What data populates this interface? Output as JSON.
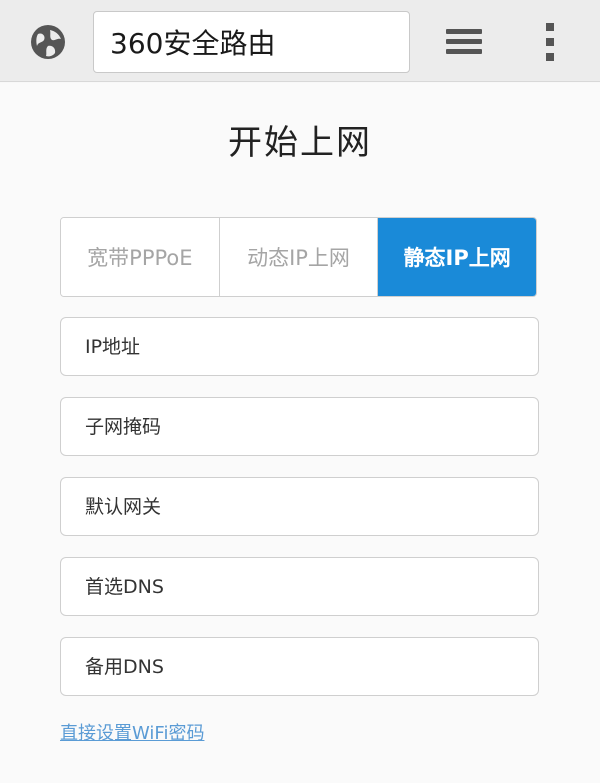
{
  "browser": {
    "url_text": "360安全路由",
    "icons": {
      "site": "globe-icon",
      "tabs": "tabs-stack-icon",
      "menu": "more-vertical-icon"
    }
  },
  "page": {
    "title": "开始上网",
    "tabs": [
      {
        "label": "宽带PPPoE",
        "active": false
      },
      {
        "label": "动态IP上网",
        "active": false
      },
      {
        "label": "静态IP上网",
        "active": true
      }
    ],
    "fields": {
      "ip_address": {
        "placeholder": "IP地址",
        "value": ""
      },
      "subnet_mask": {
        "placeholder": "子网掩码",
        "value": ""
      },
      "gateway": {
        "placeholder": "默认网关",
        "value": ""
      },
      "primary_dns": {
        "placeholder": "首选DNS",
        "value": ""
      },
      "secondary_dns": {
        "placeholder": "备用DNS",
        "value": ""
      }
    },
    "wifi_link": "直接设置WiFi密码"
  },
  "colors": {
    "accent": "#1a8ad8",
    "link": "#5a9bd5",
    "toolbar_bg": "#ececec"
  }
}
